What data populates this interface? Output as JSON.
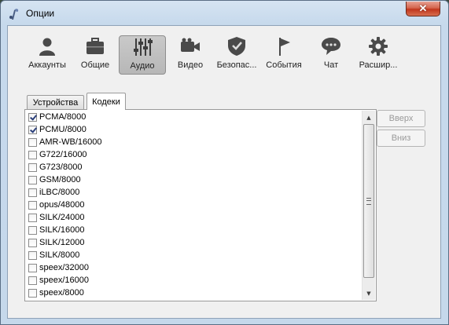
{
  "window": {
    "title": "Опции",
    "close_glyph": "✕"
  },
  "toolbar": {
    "items": [
      {
        "label": "Аккаунты",
        "icon": "user-icon"
      },
      {
        "label": "Общие",
        "icon": "briefcase-icon"
      },
      {
        "label": "Аудио",
        "icon": "equalizer-icon",
        "active": true
      },
      {
        "label": "Видео",
        "icon": "camera-icon"
      },
      {
        "label": "Безопас...",
        "icon": "shield-icon"
      },
      {
        "label": "События",
        "icon": "flag-icon"
      },
      {
        "label": "Чат",
        "icon": "chat-icon"
      },
      {
        "label": "Расшир...",
        "icon": "gear-icon"
      }
    ]
  },
  "tabs": [
    {
      "label": "Устройства",
      "active": false
    },
    {
      "label": "Кодеки",
      "active": true
    }
  ],
  "codecs": [
    {
      "name": "PCMA/8000",
      "checked": true
    },
    {
      "name": "PCMU/8000",
      "checked": true
    },
    {
      "name": "AMR-WB/16000",
      "checked": false
    },
    {
      "name": "G722/16000",
      "checked": false
    },
    {
      "name": "G723/8000",
      "checked": false
    },
    {
      "name": "GSM/8000",
      "checked": false
    },
    {
      "name": "iLBC/8000",
      "checked": false
    },
    {
      "name": "opus/48000",
      "checked": false
    },
    {
      "name": "SILK/24000",
      "checked": false
    },
    {
      "name": "SILK/16000",
      "checked": false
    },
    {
      "name": "SILK/12000",
      "checked": false
    },
    {
      "name": "SILK/8000",
      "checked": false
    },
    {
      "name": "speex/32000",
      "checked": false
    },
    {
      "name": "speex/16000",
      "checked": false
    },
    {
      "name": "speex/8000",
      "checked": false
    }
  ],
  "buttons": {
    "up": "Вверх",
    "down": "Вниз"
  }
}
